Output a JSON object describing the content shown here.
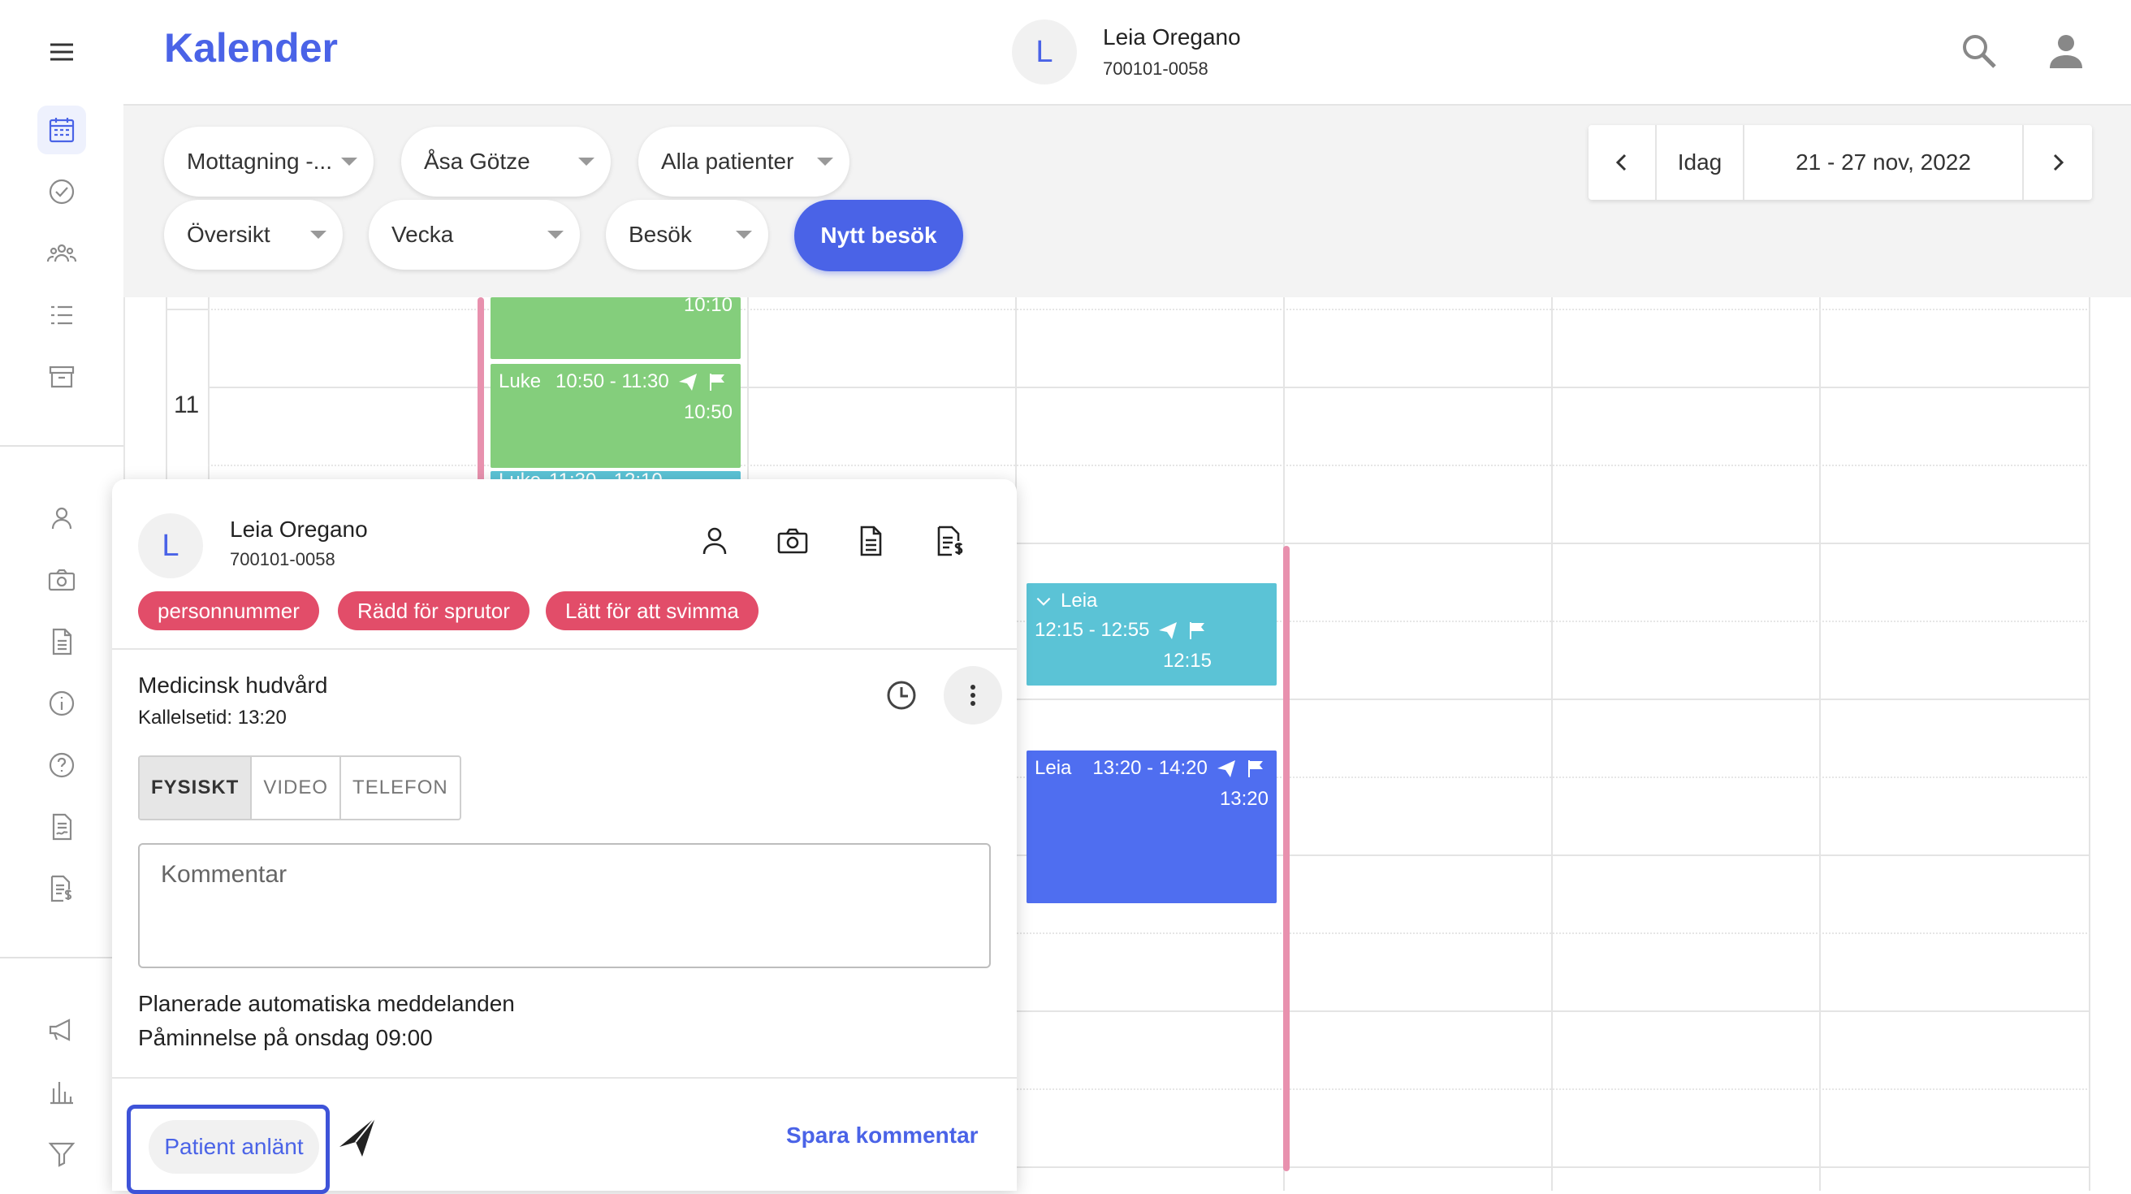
{
  "app": {
    "title": "Kalender"
  },
  "header_patient": {
    "initial": "L",
    "name": "Leia Oregano",
    "id": "700101-0058"
  },
  "filters": {
    "mottagning": "Mottagning -...",
    "practitioner": "Åsa Götze",
    "patients": "Alla patienter",
    "overview": "Översikt",
    "period": "Vecka",
    "visit_type": "Besök",
    "new_visit": "Nytt besök"
  },
  "datenav": {
    "today": "Idag",
    "range": "21 - 27 nov, 2022"
  },
  "calendar": {
    "hour_11": "11",
    "events": [
      {
        "end_label": "10:10"
      },
      {
        "name": "Luke",
        "time": "10:50 - 11:30",
        "start": "10:50"
      },
      {
        "name": "Luke",
        "time": "11:30 - 12:10"
      },
      {
        "name": "Leia",
        "time": "12:15 - 12:55",
        "start": "12:15"
      },
      {
        "name": "Leia",
        "time": "13:20 - 14:20",
        "start": "13:20"
      }
    ]
  },
  "popup": {
    "initial": "L",
    "name": "Leia Oregano",
    "id": "700101-0058",
    "tags": [
      "personnummer",
      "Rädd för sprutor",
      "Lätt för att svimma"
    ],
    "visit_title": "Medicinsk hudvård",
    "call_time": "Kallelsetid: 13:20",
    "modes": [
      "FYSISKT",
      "VIDEO",
      "TELEFON"
    ],
    "comment_placeholder": "Kommentar",
    "scheduled_title": "Planerade automatiska meddelanden",
    "reminder": "Påminnelse på onsdag 09:00",
    "patient_arrived": "Patient anlänt",
    "save_comment": "Spara kommentar"
  },
  "colors": {
    "accent": "#4a63e7",
    "green": "#84ce7c",
    "teal": "#5bc3d6",
    "tag": "#e24d69",
    "now_line": "#e891ae"
  }
}
